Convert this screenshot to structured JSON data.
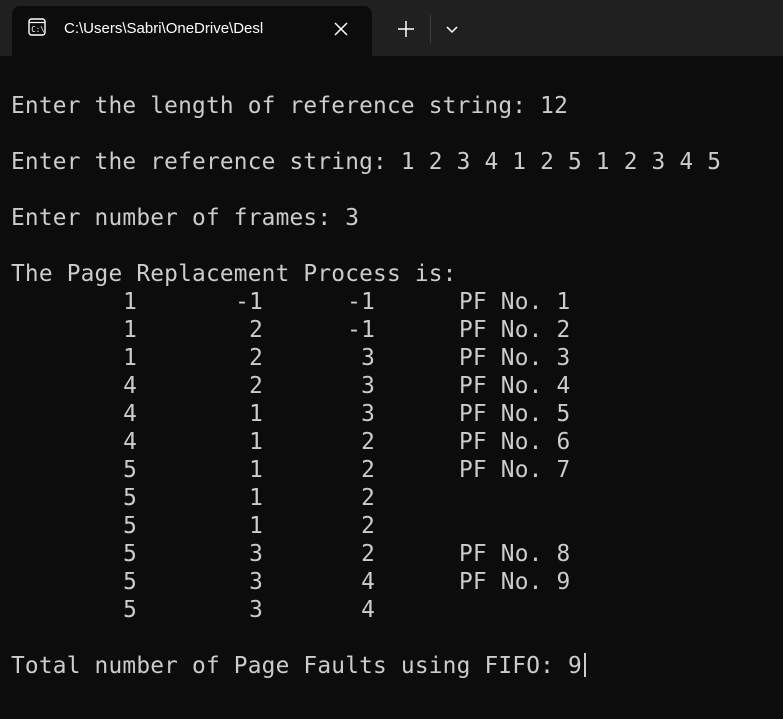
{
  "window": {
    "tab_title": "C:\\Users\\Sabri\\OneDrive\\Desl",
    "tab_icon": "terminal-icon",
    "close_icon": "close-icon",
    "new_tab_icon": "plus-icon",
    "dropdown_icon": "chevron-down-icon"
  },
  "terminal": {
    "prompt_length": "Enter the length of reference string: 12",
    "prompt_refstring": "Enter the reference string: 1 2 3 4 1 2 5 1 2 3 4 5",
    "prompt_frames": "Enter number of frames: 3",
    "process_header": "The Page Replacement Process is:",
    "rows": [
      {
        "f1": "1",
        "f2": "-1",
        "f3": "-1",
        "pf": "PF No. 1"
      },
      {
        "f1": "1",
        "f2": "2",
        "f3": "-1",
        "pf": "PF No. 2"
      },
      {
        "f1": "1",
        "f2": "2",
        "f3": "3",
        "pf": "PF No. 3"
      },
      {
        "f1": "4",
        "f2": "2",
        "f3": "3",
        "pf": "PF No. 4"
      },
      {
        "f1": "4",
        "f2": "1",
        "f3": "3",
        "pf": "PF No. 5"
      },
      {
        "f1": "4",
        "f2": "1",
        "f3": "2",
        "pf": "PF No. 6"
      },
      {
        "f1": "5",
        "f2": "1",
        "f3": "2",
        "pf": "PF No. 7"
      },
      {
        "f1": "5",
        "f2": "1",
        "f3": "2",
        "pf": ""
      },
      {
        "f1": "5",
        "f2": "1",
        "f3": "2",
        "pf": ""
      },
      {
        "f1": "5",
        "f2": "3",
        "f3": "2",
        "pf": "PF No. 8"
      },
      {
        "f1": "5",
        "f2": "3",
        "f3": "4",
        "pf": "PF No. 9"
      },
      {
        "f1": "5",
        "f2": "3",
        "f3": "4",
        "pf": ""
      }
    ],
    "total_faults": "Total number of Page Faults using FIFO: 9"
  },
  "colors": {
    "background": "#0c0c0c",
    "tabbar": "#202020",
    "text": "#cccccc"
  }
}
